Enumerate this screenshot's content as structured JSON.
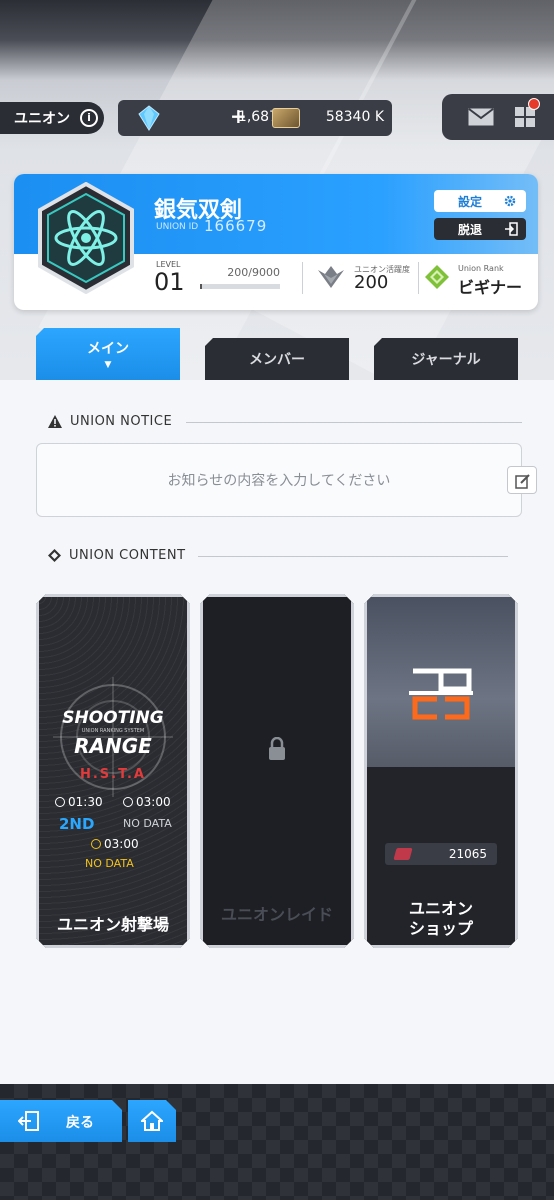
{
  "header": {
    "title": "ユニオン",
    "gem_count": "1,687",
    "gem_plus": "+",
    "credit_count": "58340 K"
  },
  "union": {
    "name": "銀気双剣",
    "id_label": "UNION ID",
    "id": "166679",
    "settings_label": "設定",
    "leave_label": "脱退",
    "level_label": "LEVEL",
    "level": "01",
    "exp": "200/9000",
    "exp_fraction": 0.022,
    "activity_label": "ユニオン活躍度",
    "activity": "200",
    "rank_label": "Union Rank",
    "rank": "ビギナー"
  },
  "tabs": [
    {
      "label": "メイン",
      "active": true
    },
    {
      "label": "メンバー",
      "active": false
    },
    {
      "label": "ジャーナル",
      "active": false
    }
  ],
  "notice": {
    "heading": "UNION NOTICE",
    "placeholder": "お知らせの内容を入力してください"
  },
  "content": {
    "heading": "UNION CONTENT",
    "shooting": {
      "title1": "SHOOTING",
      "subtitle": "UNION RANKING SYSTEM",
      "title2": "RANGE",
      "code": "H.S.T.A",
      "time1": "01:30",
      "time2": "03:00",
      "rank": "2ND",
      "rank_status": "NO DATA",
      "time3": "03:00",
      "status": "NO DATA",
      "label": "ユニオン射撃場"
    },
    "raid": {
      "label": "ユニオンレイド"
    },
    "shop": {
      "count": "21065",
      "label1": "ユニオン",
      "label2": "ショップ"
    }
  },
  "footer": {
    "back_label": "戻る"
  },
  "colors": {
    "accent": "#1b8ee8",
    "dark": "#2a2d34",
    "alert": "#e63a2a"
  }
}
